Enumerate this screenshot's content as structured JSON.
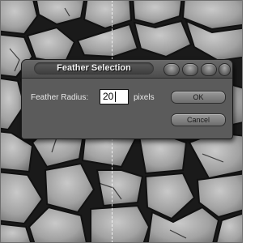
{
  "dialog": {
    "title": "Feather Selection",
    "radius_label": "Feather Radius:",
    "radius_value": "20",
    "unit_label": "pixels",
    "ok_label": "OK",
    "cancel_label": "Cancel"
  },
  "colors": {
    "dialog_bg": "#5b5b5b",
    "title_text": "#f2f2f2",
    "button_face": "#8a8a8a",
    "selection_edge": "#ffffff"
  },
  "icons": {
    "titlebar_buttons": [
      "minimize-icon",
      "maximize-icon",
      "help-icon",
      "close-icon"
    ]
  }
}
